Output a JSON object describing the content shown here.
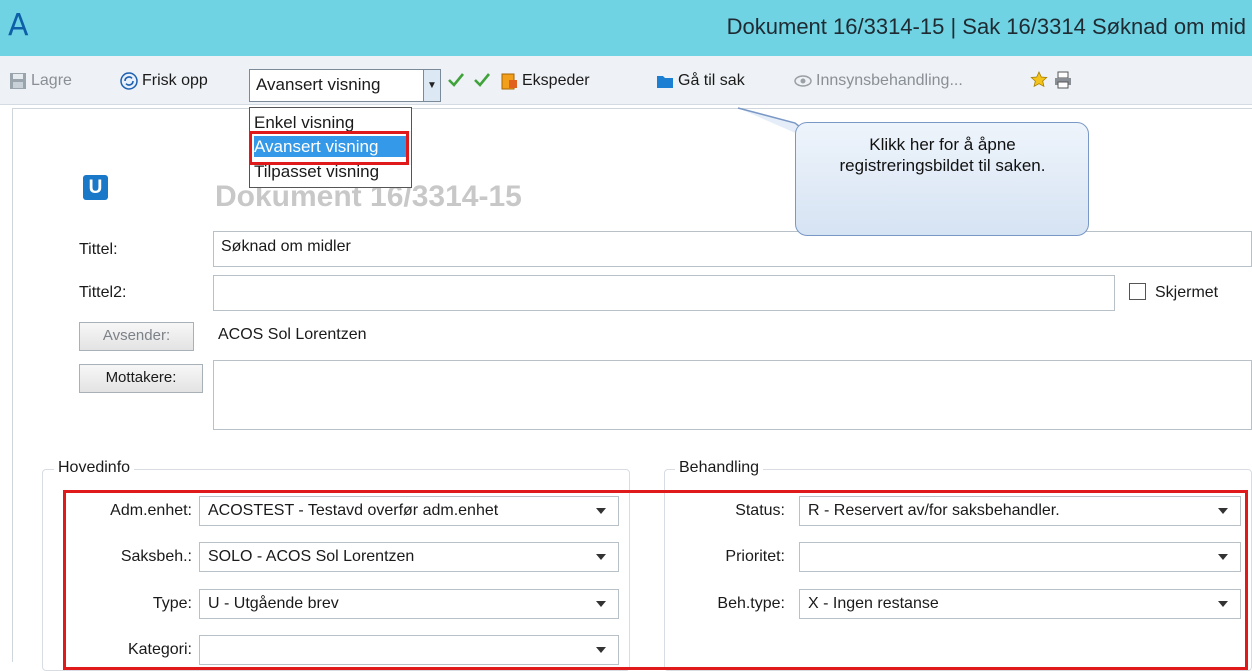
{
  "window": {
    "app_logo": "A",
    "title": "Dokument 16/3314-15 | Sak 16/3314 Søknad om mid"
  },
  "toolbar": {
    "save": "Lagre",
    "refresh": "Frisk opp",
    "view_selected": "Avansert visning",
    "dispatch": "Ekspeder",
    "go_to_case": "Gå til sak",
    "access_processing": "Innsynsbehandling..."
  },
  "view_options": [
    "Enkel visning",
    "Avansert visning",
    "Tilpasset visning"
  ],
  "callout": {
    "text": "Klikk her for å åpne registreringsbildet til saken."
  },
  "document": {
    "icon_letter": "U",
    "heading": "Dokument 16/3314-15",
    "labels": {
      "tittel": "Tittel:",
      "tittel2": "Tittel2:",
      "avsender": "Avsender:",
      "mottakere": "Mottakere:",
      "skjermet": "Skjermet"
    },
    "values": {
      "tittel": "Søknad om midler",
      "tittel2": "",
      "avsender": "ACOS Sol Lorentzen"
    }
  },
  "hovedinfo": {
    "title": "Hovedinfo",
    "fields": [
      {
        "label": "Adm.enhet:",
        "value": "ACOSTEST - Testavd overfør adm.enhet"
      },
      {
        "label": "Saksbeh.:",
        "value": "SOLO - ACOS Sol Lorentzen"
      },
      {
        "label": "Type:",
        "value": "U - Utgående brev"
      },
      {
        "label": "Kategori:",
        "value": ""
      }
    ]
  },
  "behandling": {
    "title": "Behandling",
    "fields": [
      {
        "label": "Status:",
        "value": "R - Reservert av/for saksbehandler."
      },
      {
        "label": "Prioritet:",
        "value": ""
      },
      {
        "label": "Beh.type:",
        "value": "X - Ingen restanse"
      }
    ]
  }
}
